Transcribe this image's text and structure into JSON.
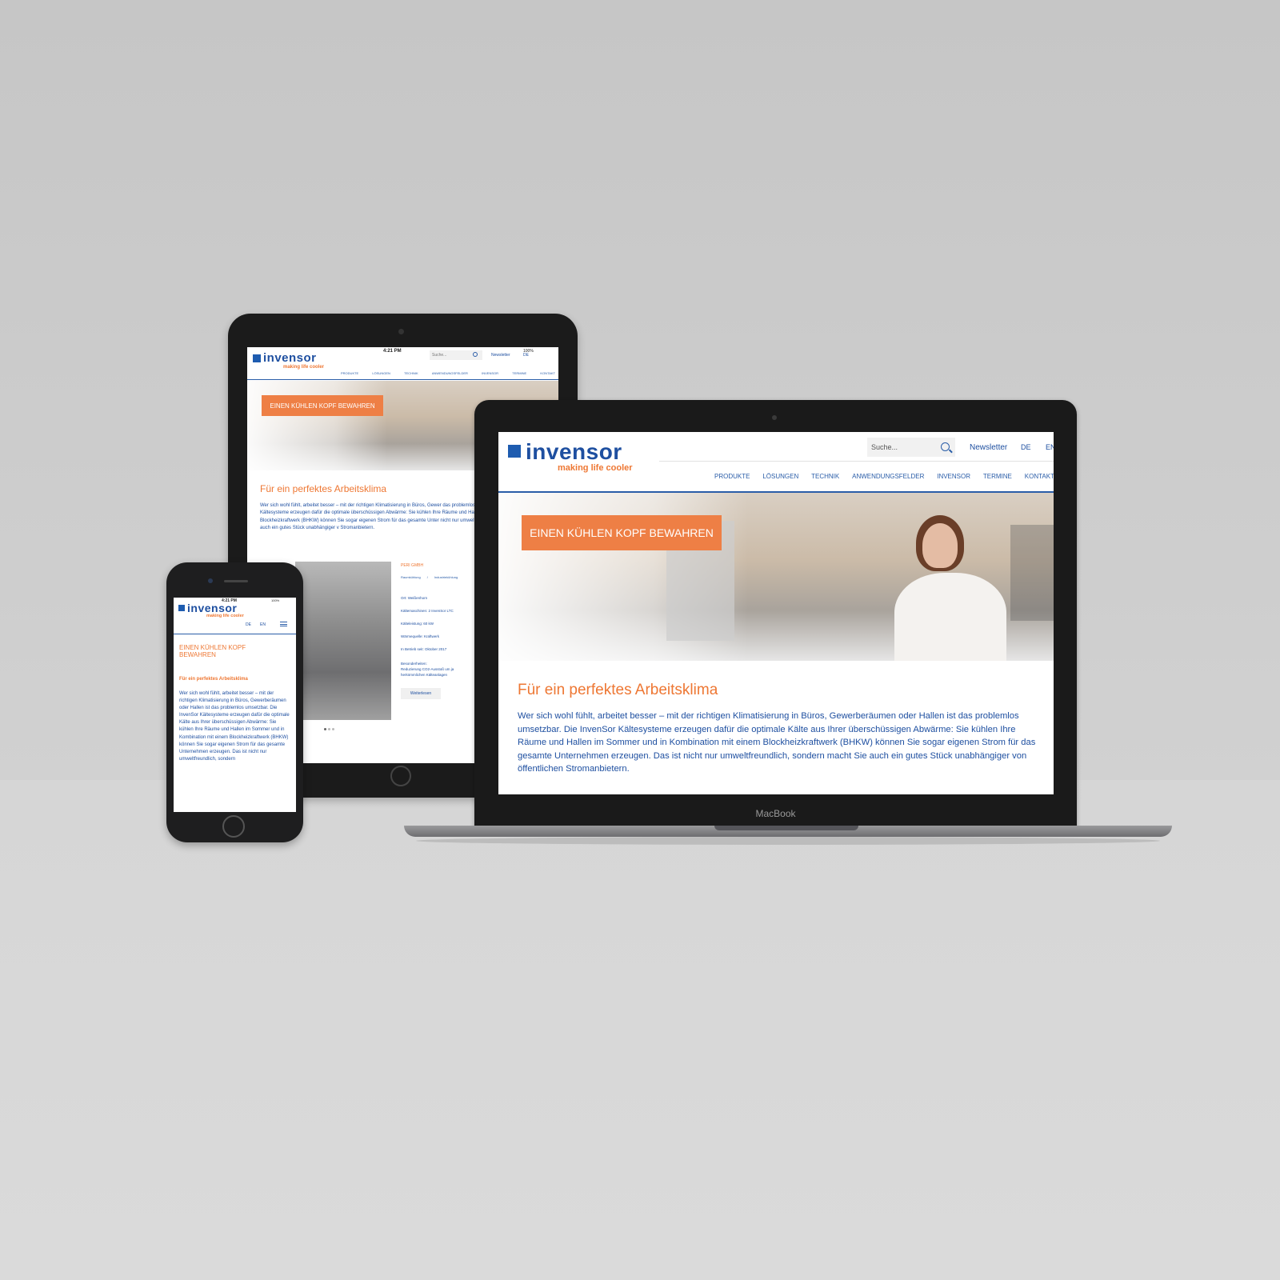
{
  "brand": {
    "name": "invensor",
    "tagline": "making life cooler",
    "colors": {
      "orange": "#ee7733",
      "blue": "#1e4fa0"
    }
  },
  "search": {
    "placeholder": "Suche..."
  },
  "header": {
    "newsletter": "Newsletter",
    "lang_de": "DE",
    "lang_en": "EN"
  },
  "nav": [
    "PRODUKTE",
    "LÖSUNGEN",
    "TECHNIK",
    "ANWENDUNGSFELDER",
    "INVENSOR",
    "TERMINE",
    "KONTAKT"
  ],
  "hero": {
    "cta": "EINEN KÜHLEN KOPF BEWAHREN"
  },
  "intro": {
    "heading": "Für ein perfektes Arbeitsklima",
    "body": "Wer sich wohl fühlt, arbeitet besser – mit der richtigen Klimatisierung in Büros, Gewerberäumen oder Hallen ist das problemlos umsetzbar. Die InvenSor Kältesysteme erzeugen dafür die optimale Kälte aus Ihrer überschüssigen Abwärme: Sie kühlen Ihre Räume und Hallen im Sommer und in Kombination mit einem Blockheizkraftwerk (BHKW) können Sie sogar eigenen Strom für das gesamte Unternehmen erzeugen. Das ist nicht nur umweltfreundlich, sondern macht Sie auch ein gutes Stück unabhängiger von öffentlichen Stromanbietern."
  },
  "tablet": {
    "status_time": "4:21 PM",
    "status_battery": "100%",
    "intro_body": "Wer sich wohl fühlt, arbeitet besser – mit der richtigen Klimatisierung in Büros, Gewer das problemlos umsetzbar. Die InvenSor Kältesysteme erzeugen dafür die optimale überschüssigen Abwärme: Sie kühlen Ihre Räume und Hallen im Sommer und in Ko Blockheizkraftwerk (BHKW) können Sie sogar eigenen Strom für das gesamte Unter nicht nur umweltfreundlich, sondern macht Sie auch ein gutes Stück unabhängiger v Stromanbietern.",
    "reference": {
      "title": "PERI GMBH",
      "tags": [
        "Raumkühlung",
        "/",
        "Industriekühlung"
      ],
      "facts": [
        "Ort: Weißenhorn",
        "Kältemaschinen: 2 InvenSor LTC",
        "Kälteleistung: 60 kW",
        "Wärmequelle: Kraftwerk",
        "In Betrieb seit: Oktober 2017"
      ],
      "special_label": "Besonderheiten:",
      "special_text": "Reduzierung CO2-Ausstoß um ja herkömmlichen Kälteanlagen",
      "more": "Weiterlesen"
    }
  },
  "phone": {
    "status_time": "4:21 PM",
    "status_battery": "100%",
    "cta": "EINEN KÜHLEN KOPF BEWAHREN",
    "heading": "Für ein perfektes Arbeitsklima",
    "body": "Wer sich wohl fühlt, arbeitet besser – mit der richtigen Klimatisierung in Büros, Gewerberäumen oder Hallen ist das problemlos umsetzbar. Die InvenSor Kältesysteme erzeugen dafür die optimale Kälte aus Ihrer überschüssigen Abwärme: Sie kühlen Ihre Räume und Hallen im Sommer und in Kombination mit einem Blockheizkraftwerk (BHKW) können Sie sogar eigenen Strom für das gesamte Unternehmen erzeugen. Das ist nicht nur umweltfreundlich, sondern"
  },
  "laptop": {
    "brand": "MacBook"
  }
}
